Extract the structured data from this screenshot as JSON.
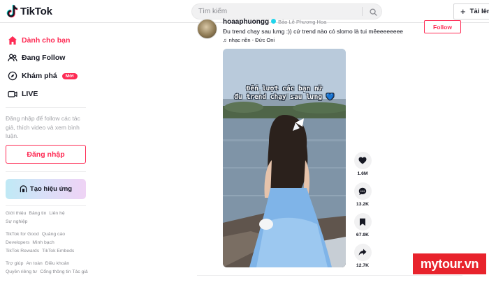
{
  "app": {
    "name": "TikTok"
  },
  "search": {
    "placeholder": "Tìm kiếm"
  },
  "header": {
    "upload_label": "Tải lên"
  },
  "sidebar": {
    "nav": [
      {
        "label": "Dành cho bạn",
        "icon": "home-icon",
        "active": true
      },
      {
        "label": "Đang Follow",
        "icon": "users-icon",
        "active": false
      },
      {
        "label": "Khám phá",
        "icon": "compass-icon",
        "active": false,
        "badge": "Mới"
      },
      {
        "label": "LIVE",
        "icon": "live-icon",
        "active": false
      }
    ],
    "login_hint": "Đăng nhập để follow các tác giả, thích video và xem bình luận.",
    "login_button": "Đăng nhập",
    "effects_button": "Tạo hiệu ứng",
    "footer": {
      "row1": [
        "Giới thiệu",
        "Bảng tin",
        "Liên hệ",
        "Sự nghiệp"
      ],
      "row2": [
        "TikTok for Good",
        "Quảng cáo",
        "Developers",
        "Minh bạch",
        "TikTok Rewards",
        "TikTok Embeds"
      ],
      "row3": [
        "Trợ giúp",
        "An toàn",
        "Điều khoản",
        "Quyền riêng tư",
        "Cổng thông tin Tác giả"
      ]
    }
  },
  "post": {
    "username": "hoaaphuongg",
    "display_name": "Bảo Lê Phương Hoa",
    "caption": "Đu trend chạy sau lưng :)) cứ trend nào có slomo là tui mêeeeeeeee",
    "music": "nhạc nền - Đức Oni",
    "follow_label": "Follow",
    "video_overlay_line1": "Đến lượt các bạn nữ",
    "video_overlay_line2": "đu trend chạy sau lưng 💙",
    "stats": {
      "likes": "1.6M",
      "comments": "13.2K",
      "saves": "67.9K",
      "shares": "12.7K"
    }
  },
  "watermark": "mytour.vn",
  "colors": {
    "accent": "#fe2c55",
    "verified": "#20d5ec",
    "watermark": "#e8232c"
  }
}
